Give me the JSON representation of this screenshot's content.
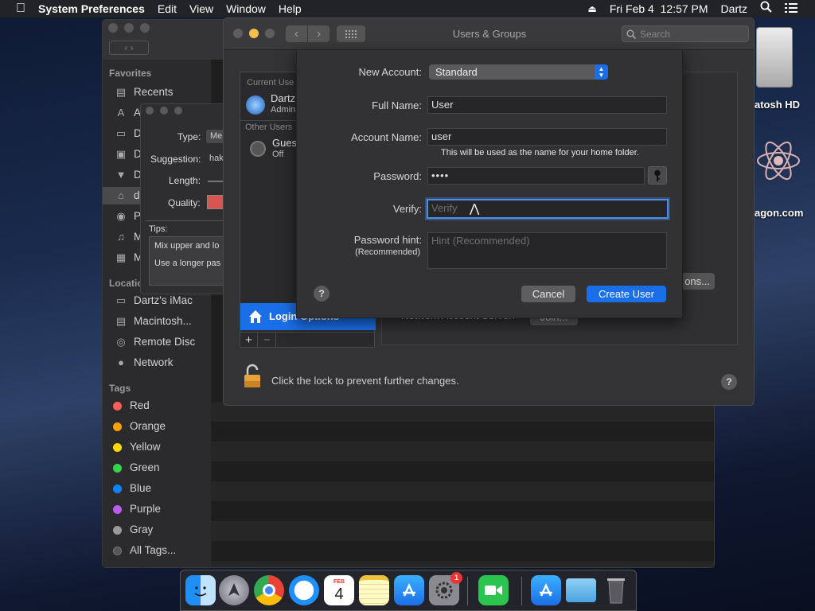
{
  "menubar": {
    "app": "System Preferences",
    "items": [
      "Edit",
      "View",
      "Window",
      "Help"
    ],
    "datetime": "Fri Feb 4  12:57 PM",
    "user": "Dartz"
  },
  "desktop": {
    "hd_label": "atosh HD",
    "web_label": "agon.com"
  },
  "finder": {
    "favorites_header": "Favorites",
    "favorites": [
      "Recents",
      "A",
      "D",
      "D",
      "D",
      "d",
      "P",
      "M",
      "M"
    ],
    "locations_header": "Location",
    "locations": [
      "Dartz's iMac",
      "Macintosh...",
      "Remote Disc",
      "Network"
    ],
    "tags_header": "Tags",
    "tags": [
      {
        "name": "Red",
        "color": "#ff5f57"
      },
      {
        "name": "Orange",
        "color": "#ff9f0a"
      },
      {
        "name": "Yellow",
        "color": "#ffd60a"
      },
      {
        "name": "Green",
        "color": "#32d74b"
      },
      {
        "name": "Blue",
        "color": "#0a84ff"
      },
      {
        "name": "Purple",
        "color": "#bf5af2"
      },
      {
        "name": "Gray",
        "color": "#9a9a9a"
      },
      {
        "name": "All Tags...",
        "color": "#555555"
      }
    ]
  },
  "password_assistant": {
    "type_label": "Type:",
    "type_value": "Me",
    "suggestion_label": "Suggestion:",
    "suggestion_value": "hak",
    "length_label": "Length:",
    "quality_label": "Quality:",
    "tips_label": "Tips:",
    "tip1": "Mix upper and lo",
    "tip2": "Use a longer pas"
  },
  "users_groups": {
    "title": "Users & Groups",
    "search_placeholder": "Search",
    "current_user_header": "Current Use",
    "current_user_name": "Dartz",
    "current_user_role": "Admin",
    "other_users_header": "Other Users",
    "guest_name": "Gues",
    "guest_status": "Off",
    "login_options": "Login Options",
    "add": "+",
    "remove": "−",
    "network_server": "Network Account Server:",
    "join": "Join...",
    "options_button": "ons...",
    "lock_text": "Click the lock to prevent further changes.",
    "help": "?"
  },
  "sheet": {
    "new_account_label": "New Account:",
    "new_account_value": "Standard",
    "full_name_label": "Full Name:",
    "full_name_value": "User",
    "account_name_label": "Account Name:",
    "account_name_value": "user",
    "account_name_note": "This will be used as the name for your home folder.",
    "password_label": "Password:",
    "password_value": "••••",
    "verify_label": "Verify:",
    "verify_placeholder": "Verify",
    "hint_label": "Password hint:",
    "hint_label2": "(Recommended)",
    "hint_placeholder": "Hint (Recommended)",
    "help": "?",
    "cancel": "Cancel",
    "create": "Create User"
  },
  "dock": {
    "calendar_month": "FEB",
    "calendar_day": "4",
    "sysprefs_badge": "1"
  },
  "colors": {
    "accent": "#1a6fe8",
    "menubar": "#222327"
  }
}
